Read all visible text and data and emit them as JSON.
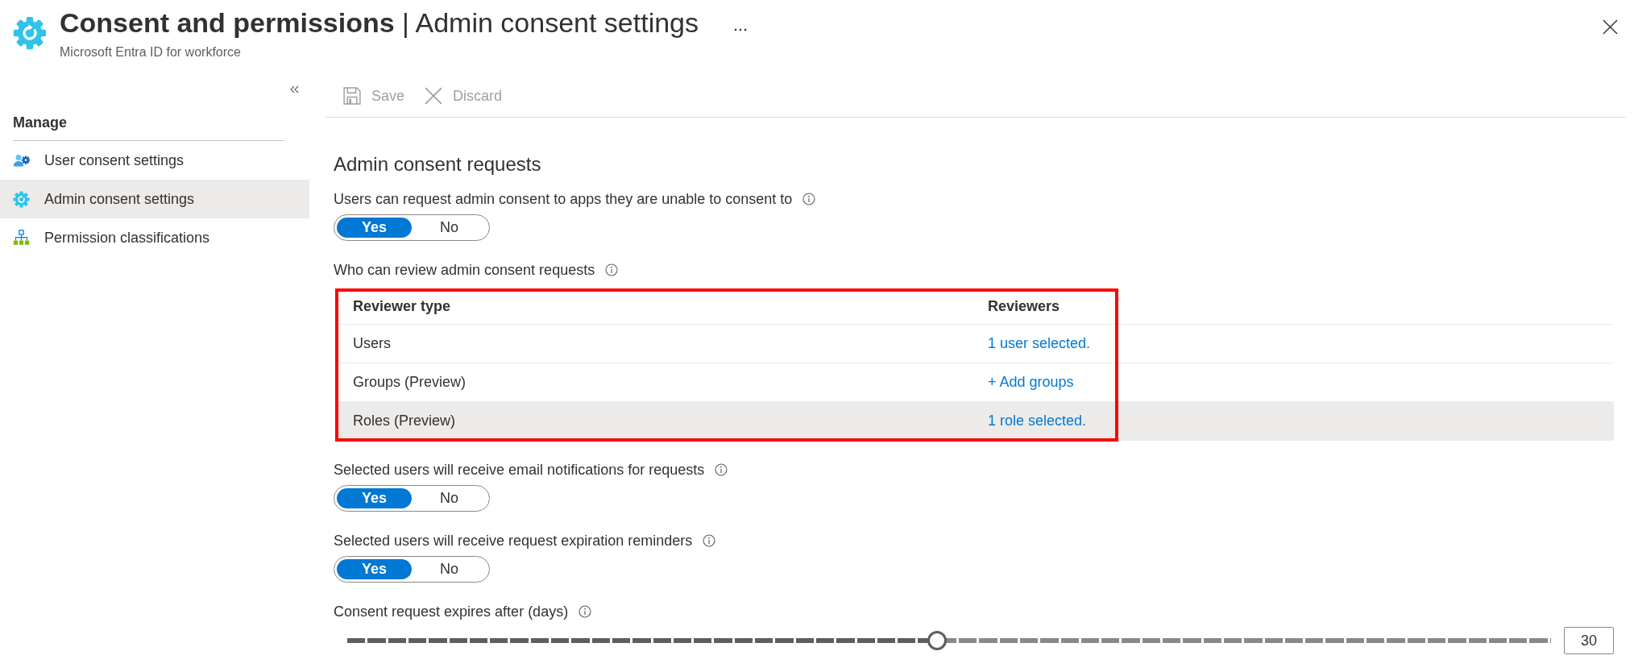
{
  "header": {
    "title": "**Consent and permissions** | Admin consent settings",
    "subtitle": "Microsoft Entra ID for workforce"
  },
  "sidebar": {
    "heading": "Manage",
    "items": [
      {
        "label": "User consent settings",
        "selected": false
      },
      {
        "label": "Admin consent settings",
        "selected": true
      },
      {
        "label": "Permission classifications",
        "selected": false
      }
    ]
  },
  "toolbar": [
    {
      "label": "Save",
      "disabled": true
    },
    {
      "label": "Discard",
      "disabled": true
    }
  ],
  "main": {
    "heading": "Admin consent requests",
    "settings": [
      {
        "kind": "toggle",
        "label": "Users can request admin consent to apps they are unable to consent to",
        "options": [
          {
            "label": "Yes",
            "selected": true
          },
          {
            "label": "No",
            "selected": false
          }
        ]
      },
      {
        "kind": "table",
        "label": "Who can review admin consent requests",
        "highlighted": true,
        "columns": [
          "Reviewer type",
          "Reviewers"
        ],
        "rows": [
          {
            "cells": [
              "Users",
              "1 user selected."
            ],
            "selected": false
          },
          {
            "cells": [
              "Groups (Preview)",
              "+ Add groups"
            ],
            "selected": false
          },
          {
            "cells": [
              "Roles (Preview)",
              "1 role selected."
            ],
            "selected": true
          }
        ]
      },
      {
        "kind": "toggle",
        "label": "Selected users will receive email notifications for requests",
        "options": [
          {
            "label": "Yes",
            "selected": true
          },
          {
            "label": "No",
            "selected": false
          }
        ]
      },
      {
        "kind": "toggle",
        "label": "Selected users will receive request expiration reminders",
        "options": [
          {
            "label": "Yes",
            "selected": true
          },
          {
            "label": "No",
            "selected": false
          }
        ]
      },
      {
        "kind": "slider",
        "label": "Consent request expires after (days)",
        "level": 0.49,
        "value": "30"
      }
    ]
  }
}
